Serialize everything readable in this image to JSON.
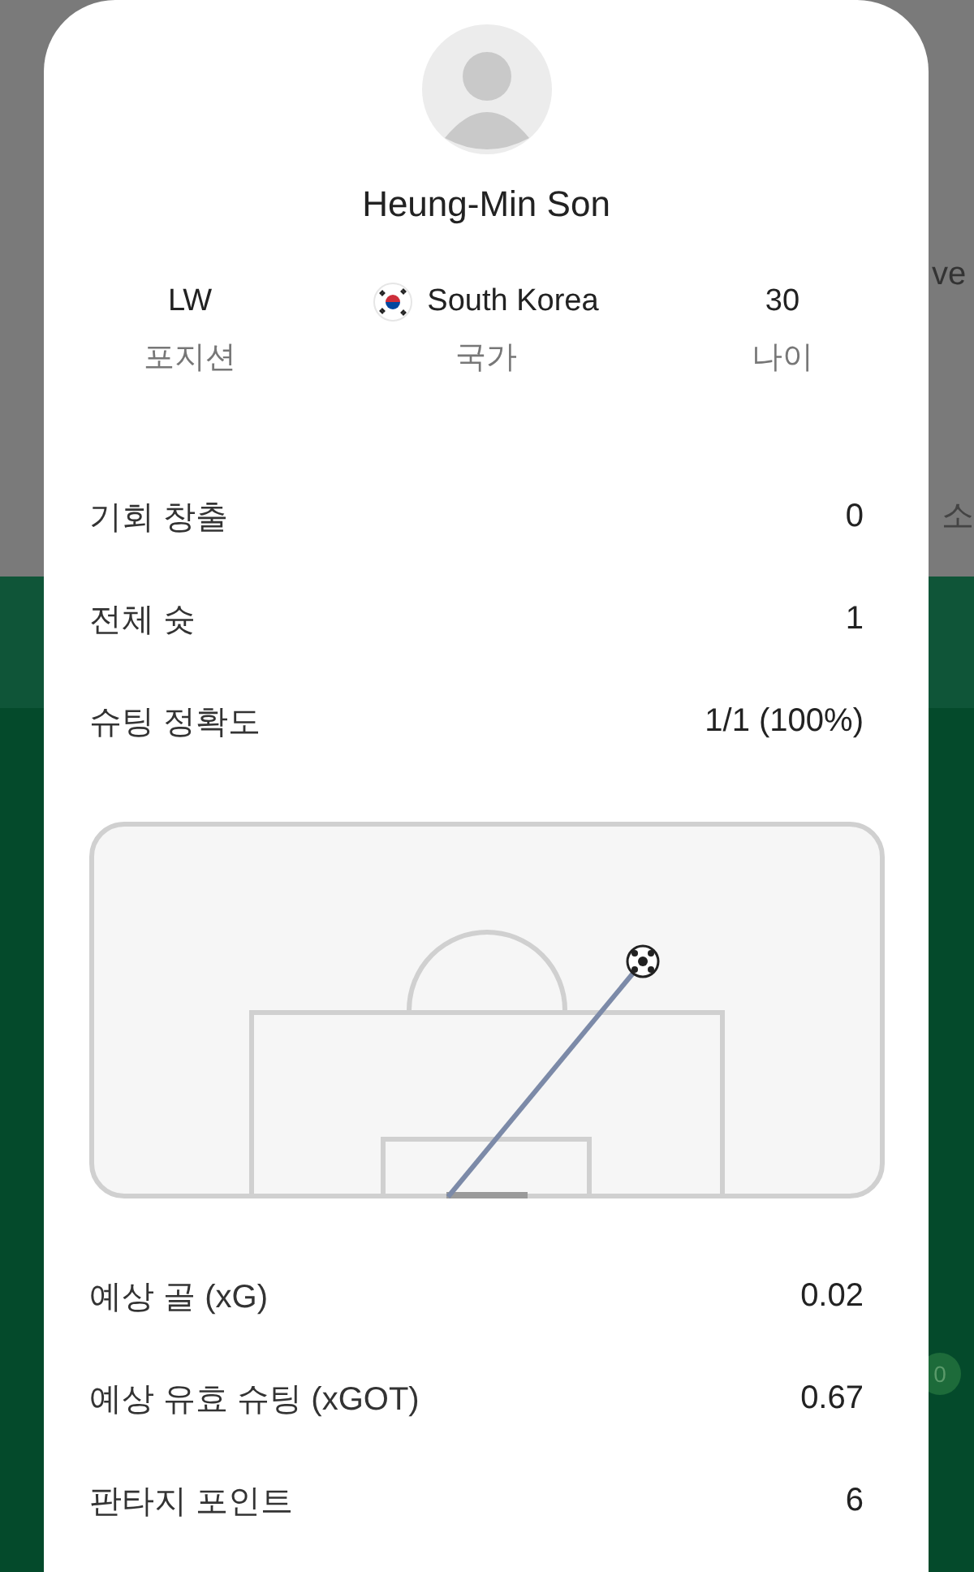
{
  "background_peek": [
    {
      "kind": "text",
      "text": "ve"
    },
    {
      "kind": "text",
      "text": "소"
    },
    {
      "kind": "badge",
      "text": "0"
    }
  ],
  "player": {
    "name": "Heung-Min Son"
  },
  "info": [
    {
      "kind": "plain",
      "value": "LW",
      "label": "포지션"
    },
    {
      "kind": "flag",
      "value": "South Korea",
      "label": "국가"
    },
    {
      "kind": "plain",
      "value": "30",
      "label": "나이"
    }
  ],
  "stats_top": [
    {
      "label": "기회 창출",
      "value": "0"
    },
    {
      "label": "전체 슛",
      "value": "1"
    },
    {
      "label": "슈팅 정확도",
      "value": "1/1 (100%)"
    }
  ],
  "stats_bottom": [
    {
      "label": "예상 골 (xG)",
      "value": "0.02"
    },
    {
      "label": "예상 유효 슈팅 (xGOT)",
      "value": "0.67"
    },
    {
      "label": "판타지 포인트",
      "value": "6"
    }
  ]
}
